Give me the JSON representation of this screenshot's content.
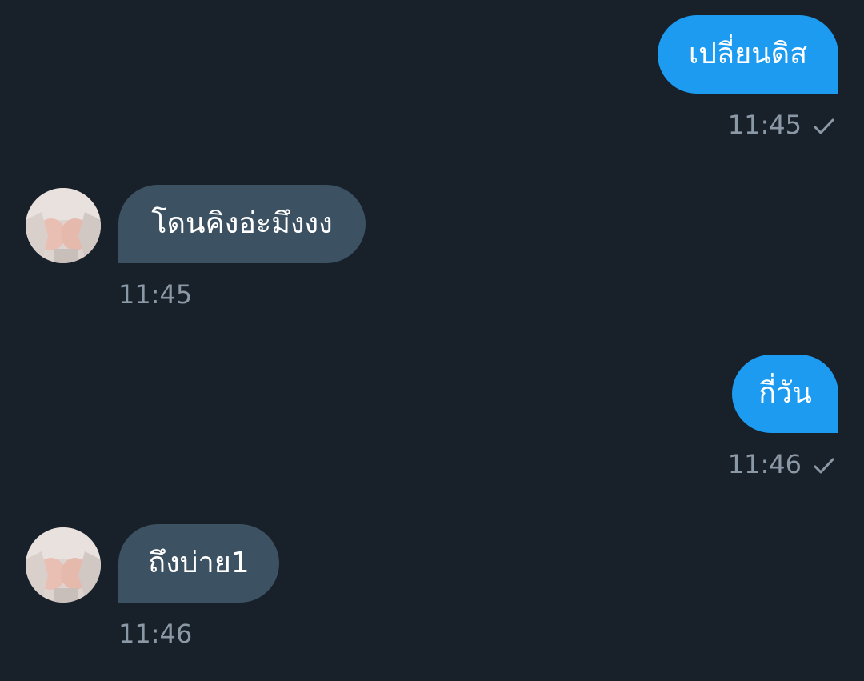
{
  "colors": {
    "background": "#18202a",
    "outgoing_bubble": "#1d9bf0",
    "incoming_bubble": "#3c5162",
    "meta_text": "#8b98a5"
  },
  "messages": [
    {
      "direction": "out",
      "text": "เปลี่ยนดิส",
      "time": "11:45",
      "status_icon": "check-icon"
    },
    {
      "direction": "in",
      "text": "โดนคิงอ่ะมึงงง",
      "time": "11:45",
      "avatar_icon": "avatar-photo"
    },
    {
      "direction": "out",
      "text": "กี่วัน",
      "time": "11:46",
      "status_icon": "check-icon"
    },
    {
      "direction": "in",
      "text": "ถึงบ่าย1",
      "time": "11:46",
      "avatar_icon": "avatar-photo"
    }
  ]
}
